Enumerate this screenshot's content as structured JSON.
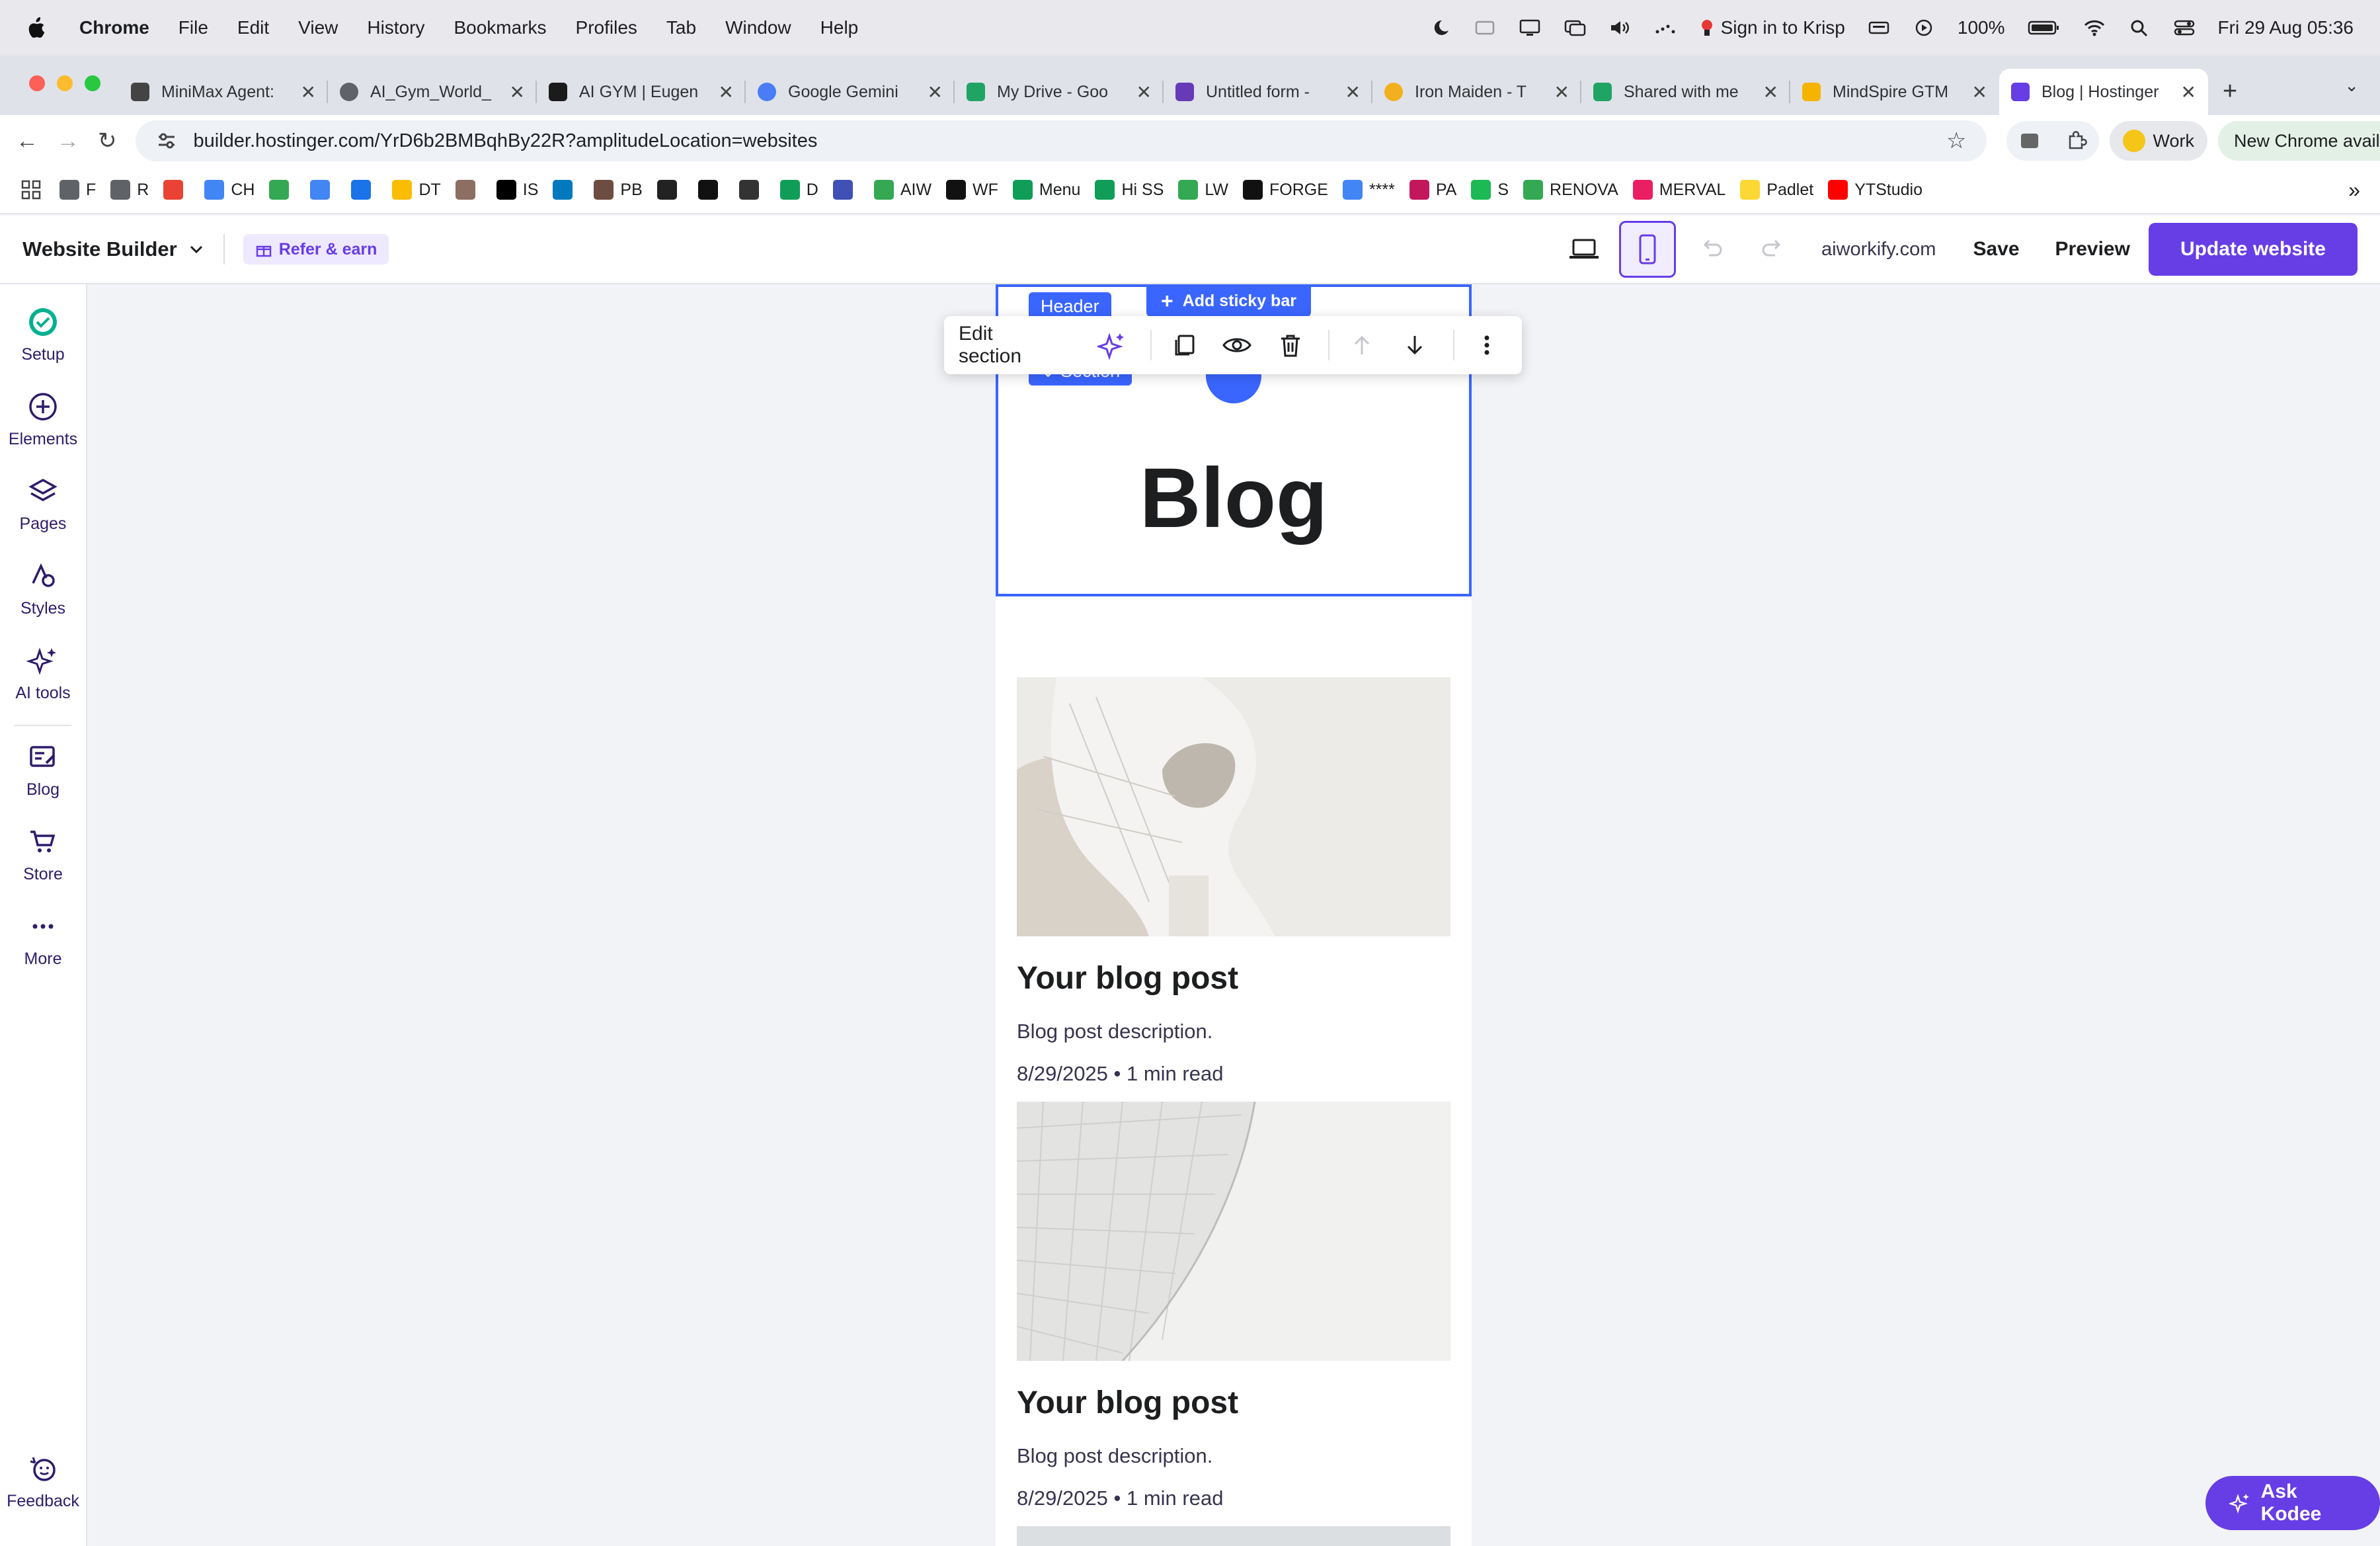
{
  "menubar": {
    "app": "Chrome",
    "items": [
      "File",
      "Edit",
      "View",
      "History",
      "Bookmarks",
      "Profiles",
      "Tab",
      "Window",
      "Help"
    ],
    "krisp": "Sign in to Krisp",
    "battery": "100%",
    "datetime": "Fri 29 Aug  05:36"
  },
  "tabs": [
    {
      "title": "MiniMax Agent:",
      "color": "#444"
    },
    {
      "title": "AI_Gym_World_",
      "color": "#5f6368"
    },
    {
      "title": "AI GYM | Eugen",
      "color": "#1b1b1b"
    },
    {
      "title": "Google Gemini",
      "color": "#4a7cf7"
    },
    {
      "title": "My Drive - Goo",
      "color": "#1fa463"
    },
    {
      "title": "Untitled form -",
      "color": "#673ab7"
    },
    {
      "title": "Iron Maiden - T",
      "color": "#f2b01e"
    },
    {
      "title": "Shared with me",
      "color": "#1fa463"
    },
    {
      "title": "MindSpire GTM",
      "color": "#f4b400"
    },
    {
      "title": "Blog | Hostinger",
      "color": "#673de6"
    }
  ],
  "address": {
    "url": "builder.hostinger.com/YrD6b2BMBqhBy22R?amplitudeLocation=websites",
    "profile": "Work",
    "update": "New Chrome available"
  },
  "bookmarks": [
    {
      "label": "F",
      "color": "#5f6368"
    },
    {
      "label": "R",
      "color": "#5f6368"
    },
    {
      "label": "",
      "color": "#ea4335"
    },
    {
      "label": "CH",
      "color": "#4285f4"
    },
    {
      "label": "",
      "color": "#34a853"
    },
    {
      "label": "",
      "color": "#4285f4"
    },
    {
      "label": "",
      "color": "#1a73e8"
    },
    {
      "label": "DT",
      "color": "#fbbc04"
    },
    {
      "label": "",
      "color": "#8d6e63"
    },
    {
      "label": "IS",
      "color": "#000000"
    },
    {
      "label": "",
      "color": "#0079bf"
    },
    {
      "label": "PB",
      "color": "#6d4c41"
    },
    {
      "label": "",
      "color": "#222222"
    },
    {
      "label": "",
      "color": "#111111"
    },
    {
      "label": "",
      "color": "#333333"
    },
    {
      "label": "D",
      "color": "#0f9d58"
    },
    {
      "label": "",
      "color": "#3f51b5"
    },
    {
      "label": "AIW",
      "color": "#34a853"
    },
    {
      "label": "WF",
      "color": "#111111"
    },
    {
      "label": "Menu",
      "color": "#0f9d58"
    },
    {
      "label": "Hi SS",
      "color": "#0f9d58"
    },
    {
      "label": "LW",
      "color": "#34a853"
    },
    {
      "label": "FORGE",
      "color": "#111111"
    },
    {
      "label": "****",
      "color": "#4285f4"
    },
    {
      "label": "PA",
      "color": "#c2185b"
    },
    {
      "label": "S",
      "color": "#1db954"
    },
    {
      "label": "RENOVA",
      "color": "#34a853"
    },
    {
      "label": "MERVAL",
      "color": "#e91e63"
    },
    {
      "label": "Padlet",
      "color": "#fdd835"
    },
    {
      "label": "YTStudio",
      "color": "#ff0000"
    }
  ],
  "builder": {
    "title": "Website Builder",
    "refer": "Refer & earn",
    "domain": "aiworkify.com",
    "save": "Save",
    "preview": "Preview",
    "update": "Update website",
    "accent": "#673de6"
  },
  "sidebar": [
    {
      "label": "Setup",
      "icon": "setup-icon"
    },
    {
      "label": "Elements",
      "icon": "plus-circle-icon"
    },
    {
      "label": "Pages",
      "icon": "layers-icon"
    },
    {
      "label": "Styles",
      "icon": "styles-icon"
    },
    {
      "label": "AI tools",
      "icon": "sparkles-icon"
    },
    {
      "label": "Blog",
      "icon": "blog-icon"
    },
    {
      "label": "Store",
      "icon": "cart-icon"
    },
    {
      "label": "More",
      "icon": "more-icon"
    },
    {
      "label": "Feedback",
      "icon": "feedback-icon"
    }
  ],
  "canvas": {
    "header_label": "Header",
    "sticky": "Add sticky bar",
    "section_label": "Section",
    "heading": "Blog",
    "edit_section": "Edit section",
    "selection_color": "#3a66ff",
    "posts": [
      {
        "title": "Your blog post",
        "desc": "Blog post description.",
        "meta": "8/29/2025 • 1 min read"
      },
      {
        "title": "Your blog post",
        "desc": "Blog post description.",
        "meta": "8/29/2025 • 1 min read"
      }
    ]
  },
  "kodee": "Ask Kodee"
}
